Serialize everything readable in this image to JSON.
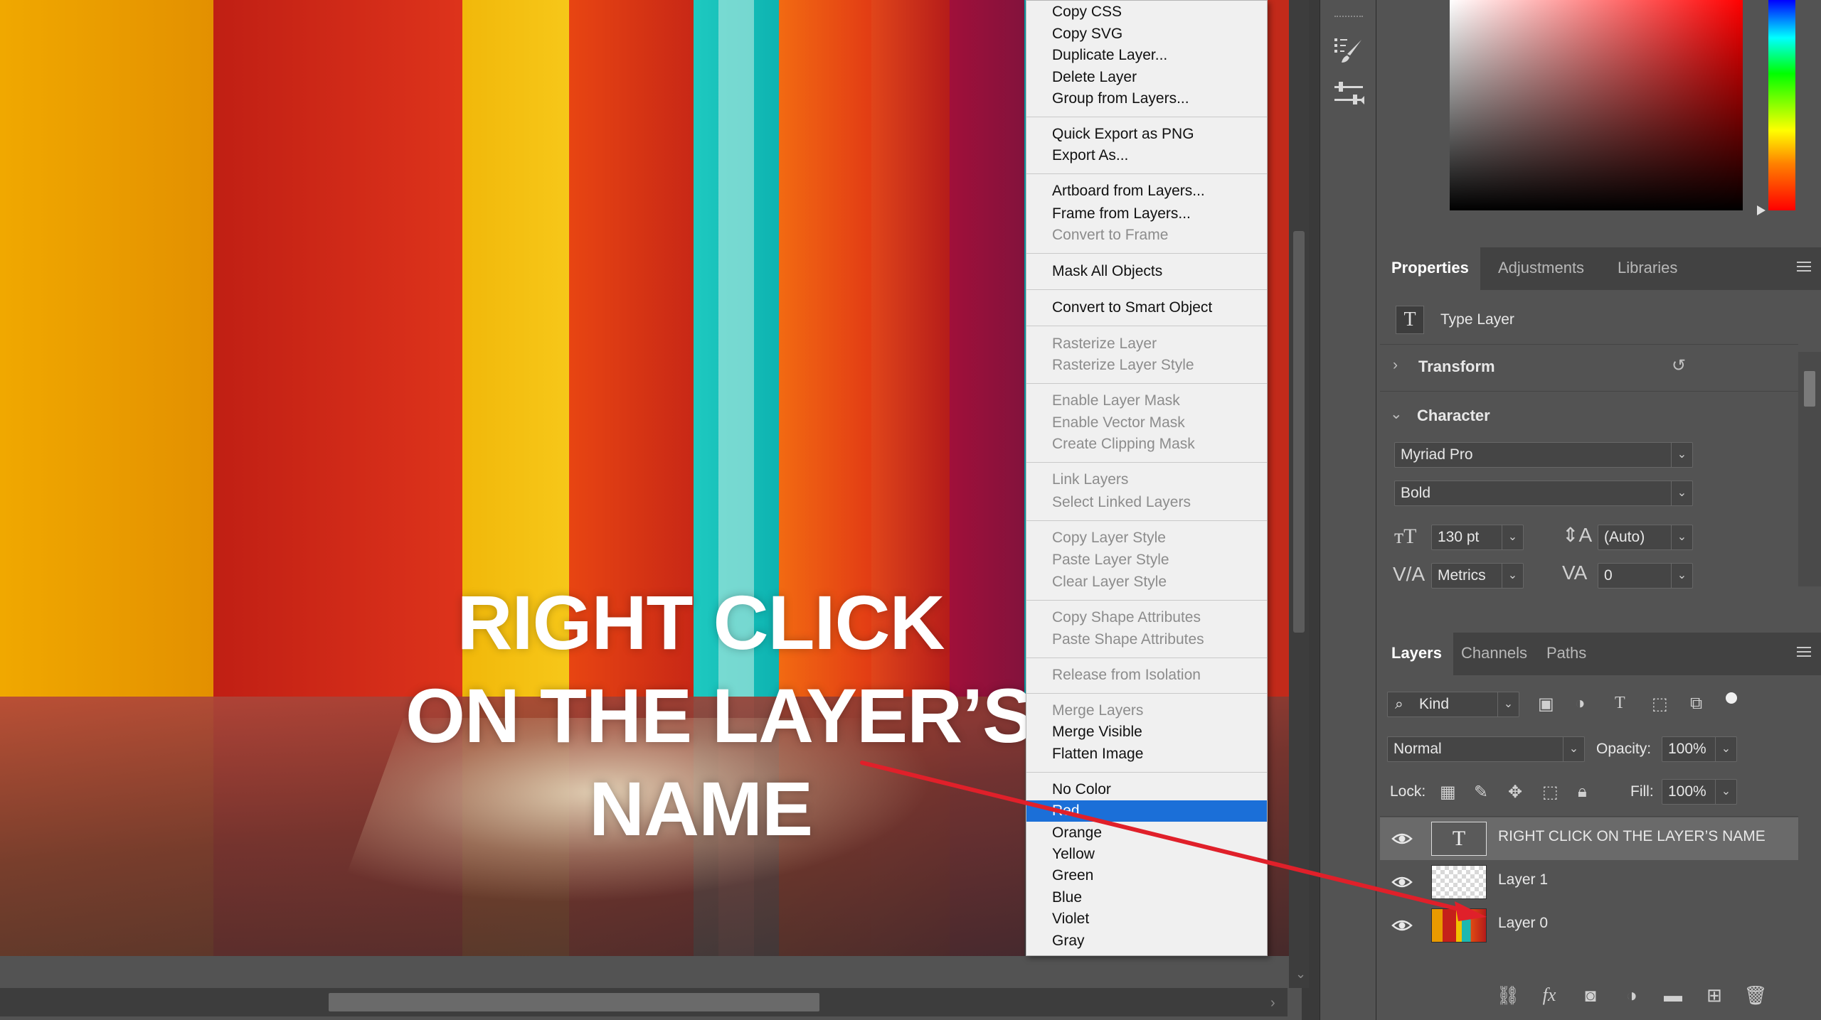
{
  "canvas": {
    "overlay_lines": [
      "RIGHT CLICK",
      "ON THE LAYER’S",
      "NAME"
    ]
  },
  "context_menu": {
    "items": [
      {
        "label": "Copy CSS",
        "enabled": true
      },
      {
        "label": "Copy SVG",
        "enabled": true
      },
      {
        "label": "Duplicate Layer...",
        "enabled": true
      },
      {
        "label": "Delete Layer",
        "enabled": true
      },
      {
        "label": "Group from Layers...",
        "enabled": true
      },
      {
        "label": "Quick Export as PNG",
        "enabled": true
      },
      {
        "label": "Export As...",
        "enabled": true
      },
      {
        "label": "Artboard from Layers...",
        "enabled": true
      },
      {
        "label": "Frame from Layers...",
        "enabled": true
      },
      {
        "label": "Convert to Frame",
        "enabled": false
      },
      {
        "label": "Mask All Objects",
        "enabled": true
      },
      {
        "label": "Convert to Smart Object",
        "enabled": true
      },
      {
        "label": "Rasterize Layer",
        "enabled": false
      },
      {
        "label": "Rasterize Layer Style",
        "enabled": false
      },
      {
        "label": "Enable Layer Mask",
        "enabled": false
      },
      {
        "label": "Enable Vector Mask",
        "enabled": false
      },
      {
        "label": "Create Clipping Mask",
        "enabled": false
      },
      {
        "label": "Link Layers",
        "enabled": false
      },
      {
        "label": "Select Linked Layers",
        "enabled": false
      },
      {
        "label": "Copy Layer Style",
        "enabled": false
      },
      {
        "label": "Paste Layer Style",
        "enabled": false
      },
      {
        "label": "Clear Layer Style",
        "enabled": false
      },
      {
        "label": "Copy Shape Attributes",
        "enabled": false
      },
      {
        "label": "Paste Shape Attributes",
        "enabled": false
      },
      {
        "label": "Release from Isolation",
        "enabled": false
      },
      {
        "label": "Merge Layers",
        "enabled": false
      },
      {
        "label": "Merge Visible",
        "enabled": true
      },
      {
        "label": "Flatten Image",
        "enabled": true
      },
      {
        "label": "No Color",
        "enabled": true
      },
      {
        "label": "Red",
        "enabled": true,
        "highlighted": true
      },
      {
        "label": "Orange",
        "enabled": true
      },
      {
        "label": "Yellow",
        "enabled": true
      },
      {
        "label": "Green",
        "enabled": true
      },
      {
        "label": "Blue",
        "enabled": true
      },
      {
        "label": "Violet",
        "enabled": true
      },
      {
        "label": "Gray",
        "enabled": true
      }
    ]
  },
  "properties_panel": {
    "tabs": [
      "Properties",
      "Adjustments",
      "Libraries"
    ],
    "active_tab": "Properties",
    "layer_kind": "Type Layer",
    "sections": {
      "transform": "Transform",
      "character": "Character"
    },
    "font_family": "Myriad Pro",
    "font_style": "Bold",
    "font_size": "130 pt",
    "leading": "(Auto)",
    "kerning": "Metrics",
    "tracking": "0"
  },
  "layers_panel": {
    "tabs": [
      "Layers",
      "Channels",
      "Paths"
    ],
    "active_tab": "Layers",
    "filter_kind": "Kind",
    "blend_mode": "Normal",
    "opacity_label": "Opacity:",
    "opacity": "100%",
    "lock_label": "Lock:",
    "fill_label": "Fill:",
    "fill": "100%",
    "layers": [
      {
        "name": "RIGHT CLICK  ON THE LAYER’S NAME",
        "type": "text",
        "selected": true
      },
      {
        "name": "Layer 1",
        "type": "transparent",
        "selected": false
      },
      {
        "name": "Layer 0",
        "type": "image",
        "selected": false
      }
    ]
  },
  "colors": {
    "menu_highlight": "#1b6fd8",
    "annotation_arrow": "#e0202a"
  }
}
